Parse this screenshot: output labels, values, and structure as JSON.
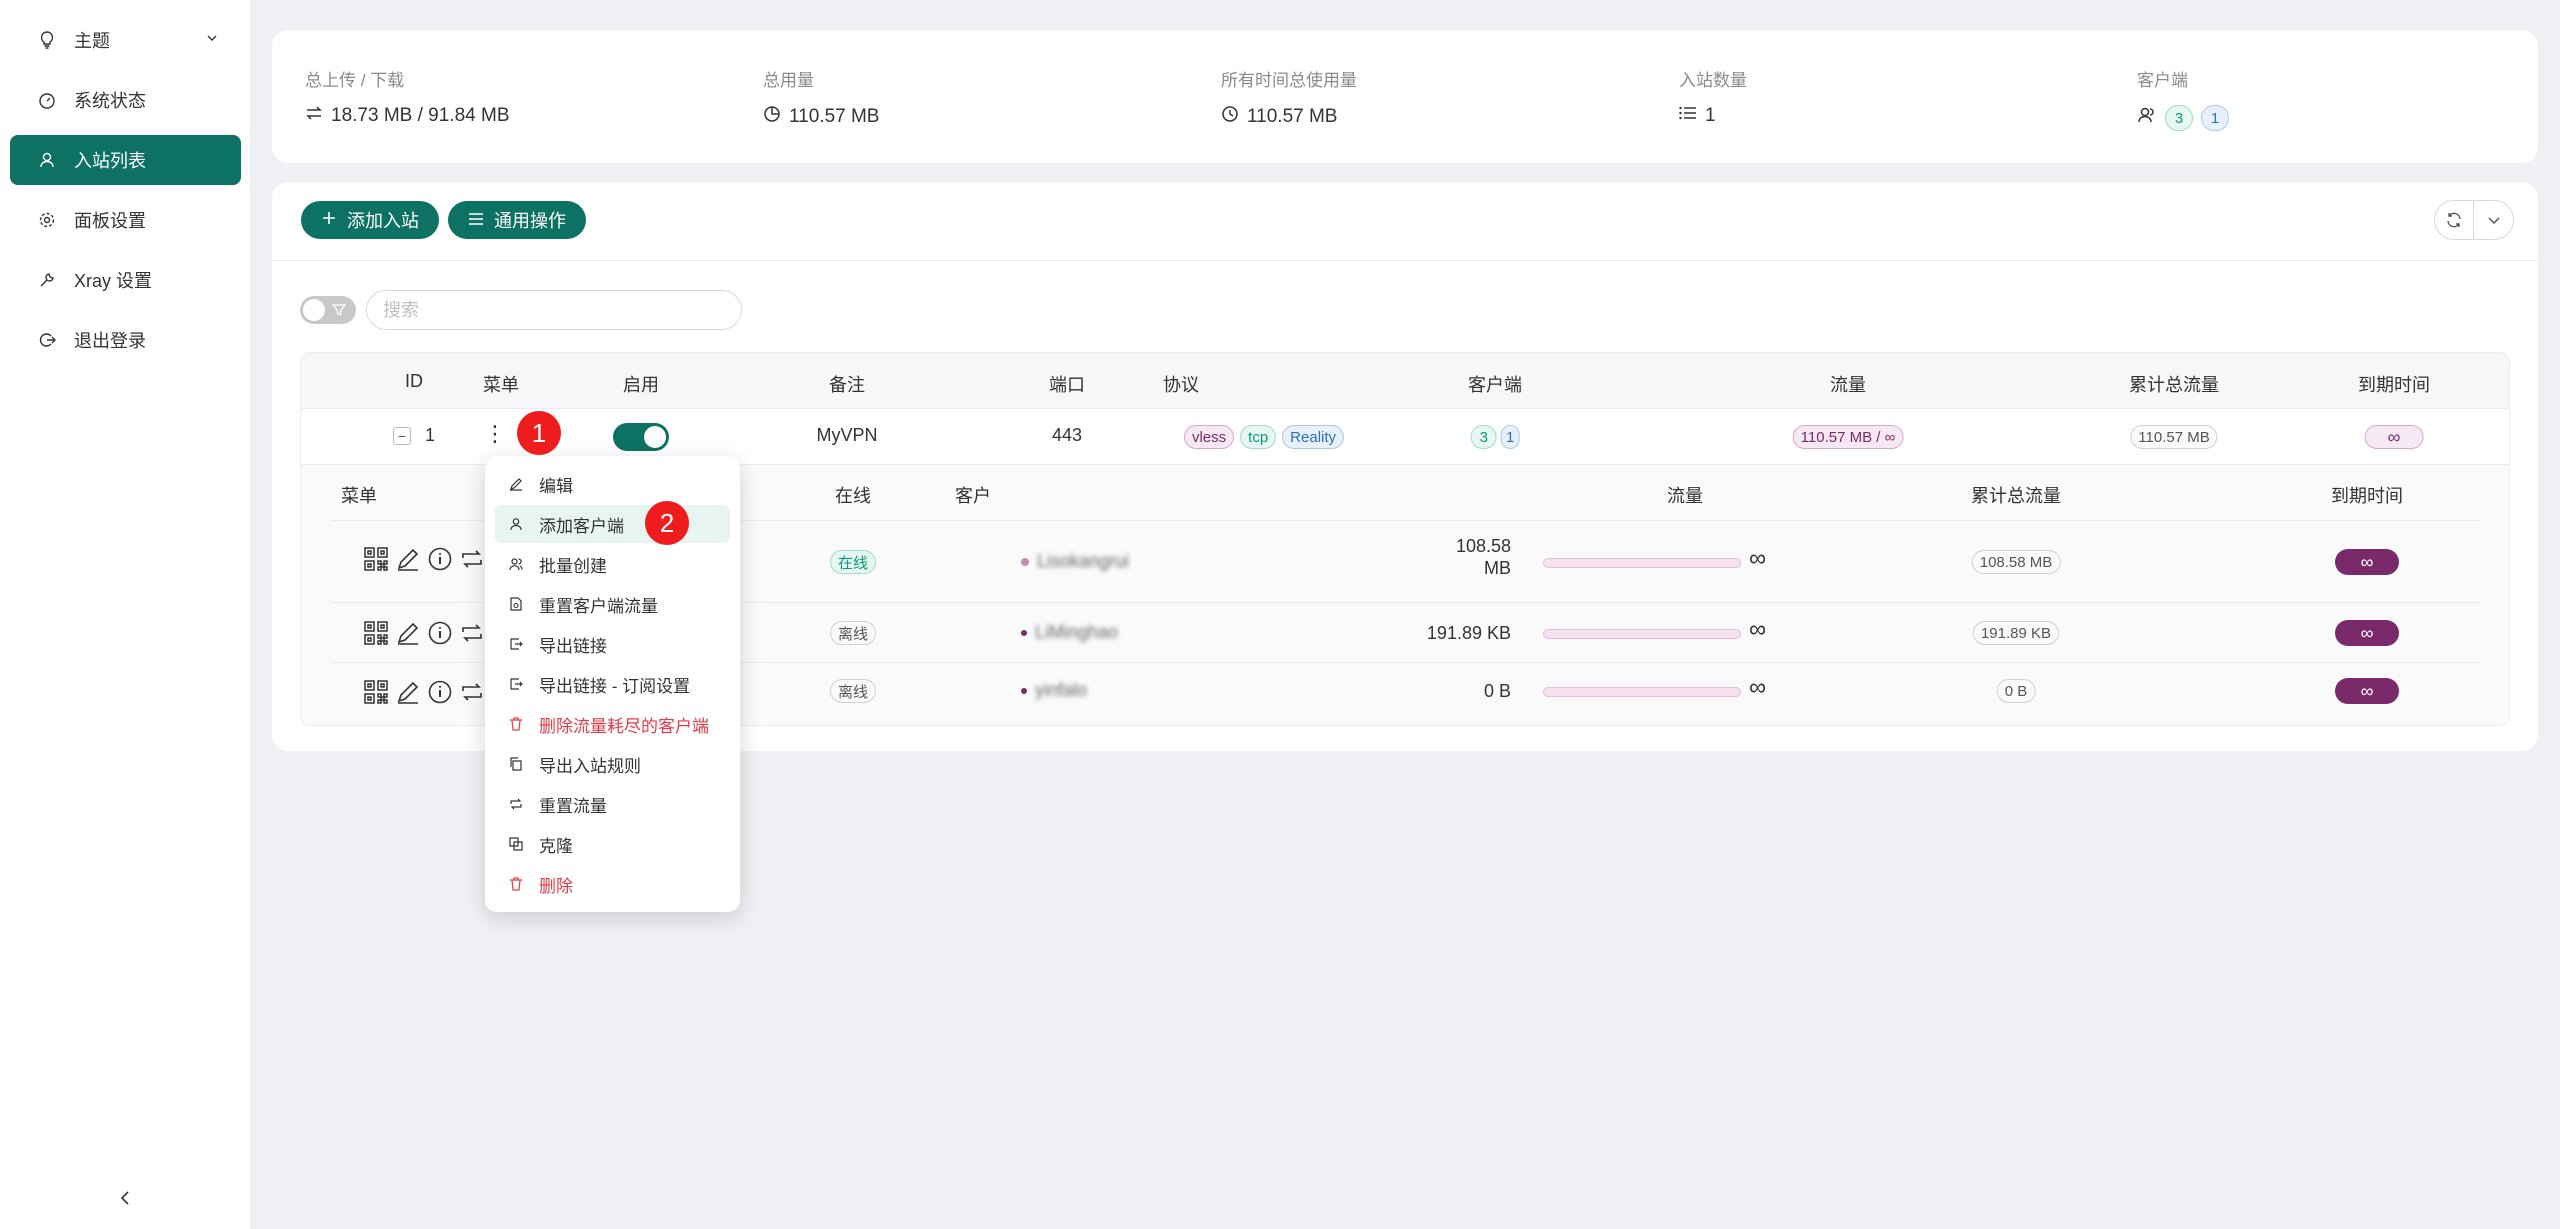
{
  "sidebar": {
    "items": [
      {
        "label": "主题",
        "icon": "bulb-icon"
      },
      {
        "label": "系统状态",
        "icon": "dashboard-icon"
      },
      {
        "label": "入站列表",
        "icon": "user-icon",
        "active": true
      },
      {
        "label": "面板设置",
        "icon": "gear-icon"
      },
      {
        "label": "Xray 设置",
        "icon": "tool-icon"
      },
      {
        "label": "退出登录",
        "icon": "logout-icon"
      }
    ]
  },
  "stats": {
    "upload_download_label": "总上传 / 下载",
    "upload_download_value": "18.73 MB / 91.84 MB",
    "total_usage_label": "总用量",
    "total_usage_value": "110.57 MB",
    "alltime_label": "所有时间总使用量",
    "alltime_value": "110.57 MB",
    "inbound_count_label": "入站数量",
    "inbound_count_value": "1",
    "clients_label": "客户端",
    "clients_count_green": "3",
    "clients_count_blue": "1"
  },
  "toolbar": {
    "add_inbound": "添加入站",
    "general_actions": "通用操作"
  },
  "search": {
    "placeholder": "搜索"
  },
  "table": {
    "headers": {
      "id": "ID",
      "menu": "菜单",
      "enable": "启用",
      "remark": "备注",
      "port": "端口",
      "protocol": "协议",
      "clients": "客户端",
      "traffic": "流量",
      "total_traffic": "累计总流量",
      "expiry": "到期时间"
    },
    "row": {
      "minus": "−",
      "id": "1",
      "menu_dots": "⋮",
      "remark": "MyVPN",
      "port": "443",
      "protocol_tags": [
        "vless",
        "tcp",
        "Reality"
      ],
      "clients_green": "3",
      "clients_blue": "1",
      "traffic": "110.57 MB / ∞",
      "total_traffic": "110.57 MB",
      "expiry": "∞"
    }
  },
  "sub_table": {
    "headers": {
      "menu": "菜单",
      "online": "在线",
      "client": "客户",
      "traffic": "流量",
      "total_traffic": "累计总流量",
      "expiry": "到期时间"
    },
    "rows": [
      {
        "online": "在线",
        "client": "Lisokangrui",
        "traffic_line1": "108.58",
        "traffic_line2": "MB",
        "traffic_fill": 1.0,
        "infinity": "∞",
        "total": "108.58 MB",
        "expiry": "∞"
      },
      {
        "online": "离线",
        "client": "LiMinghao",
        "traffic_line1": "191.89 KB",
        "traffic_line2": "",
        "traffic_fill": 1.0,
        "infinity": "∞",
        "total": "191.89 KB",
        "expiry": "∞"
      },
      {
        "online": "离线",
        "client": "yinfalo",
        "traffic_line1": "0 B",
        "traffic_line2": "",
        "traffic_fill": 1.0,
        "infinity": "∞",
        "total": "0 B",
        "expiry": "∞"
      }
    ]
  },
  "menu": {
    "items": [
      {
        "label": "编辑",
        "icon": "edit-icon"
      },
      {
        "label": "添加客户端",
        "icon": "user-add-icon"
      },
      {
        "label": "批量创建",
        "icon": "users-icon"
      },
      {
        "label": "重置客户端流量",
        "icon": "reset-file-icon"
      },
      {
        "label": "导出链接",
        "icon": "export-icon"
      },
      {
        "label": "导出链接 - 订阅设置",
        "icon": "export-icon"
      },
      {
        "label": "删除流量耗尽的客户端",
        "icon": "delete-icon"
      },
      {
        "label": "导出入站规则",
        "icon": "copy-icon"
      },
      {
        "label": "重置流量",
        "icon": "retweet-icon"
      },
      {
        "label": "克隆",
        "icon": "block-icon"
      },
      {
        "label": "删除",
        "icon": "delete-icon"
      }
    ]
  },
  "badges": {
    "one": "1",
    "two": "2"
  },
  "colors": {
    "accent": "#0d7163",
    "danger": "#e63946",
    "expiry": "#7a2a6a",
    "badge": "#ee1c1c"
  }
}
